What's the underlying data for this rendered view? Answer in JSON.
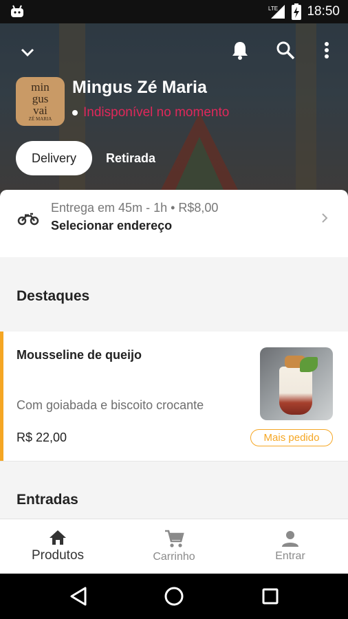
{
  "status_bar": {
    "time": "18:50",
    "network": "LTE"
  },
  "header": {
    "store_name": "Mingus Zé Maria",
    "status": "Indisponível no momento",
    "logo_text": [
      "min",
      "gus",
      "vai"
    ],
    "logo_small": "ZÉ MARIA",
    "modes": {
      "delivery": "Delivery",
      "pickup": "Retirada"
    }
  },
  "delivery": {
    "info": "Entrega em 45m - 1h • R$8,00",
    "address": "Selecionar endereço"
  },
  "sections": {
    "highlights": "Destaques",
    "starters": "Entradas"
  },
  "product": {
    "name": "Mousseline de queijo",
    "description": "Com goiabada e biscoito crocante",
    "price": "R$ 22,00",
    "badge": "Mais pedido"
  },
  "bottom_nav": {
    "products": "Produtos",
    "cart": "Carrinho",
    "login": "Entrar"
  },
  "colors": {
    "accent": "#f5a623",
    "unavailable": "#e0285a"
  }
}
